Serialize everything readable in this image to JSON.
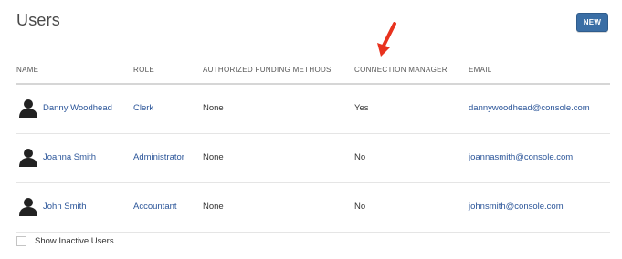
{
  "page": {
    "title": "Users",
    "new_button_label": "NEW"
  },
  "table": {
    "headers": {
      "name": "NAME",
      "role": "ROLE",
      "funding": "AUTHORIZED FUNDING METHODS",
      "connection": "CONNECTION MANAGER",
      "email": "EMAIL"
    },
    "rows": [
      {
        "name": "Danny Woodhead",
        "role": "Clerk",
        "funding": "None",
        "connection": "Yes",
        "email": "dannywoodhead@console.com"
      },
      {
        "name": "Joanna Smith",
        "role": "Administrator",
        "funding": "None",
        "connection": "No",
        "email": "joannasmith@console.com"
      },
      {
        "name": "John Smith",
        "role": "Accountant",
        "funding": "None",
        "connection": "No",
        "email": "johnsmith@console.com"
      }
    ]
  },
  "footer": {
    "show_inactive_label": "Show Inactive Users",
    "show_inactive_checked": false
  },
  "annotation": {
    "arrow_icon": "red-arrow-icon",
    "arrow_color": "#e8321e"
  },
  "colors": {
    "accent": "#3a6ea5",
    "link": "#2b5599"
  }
}
